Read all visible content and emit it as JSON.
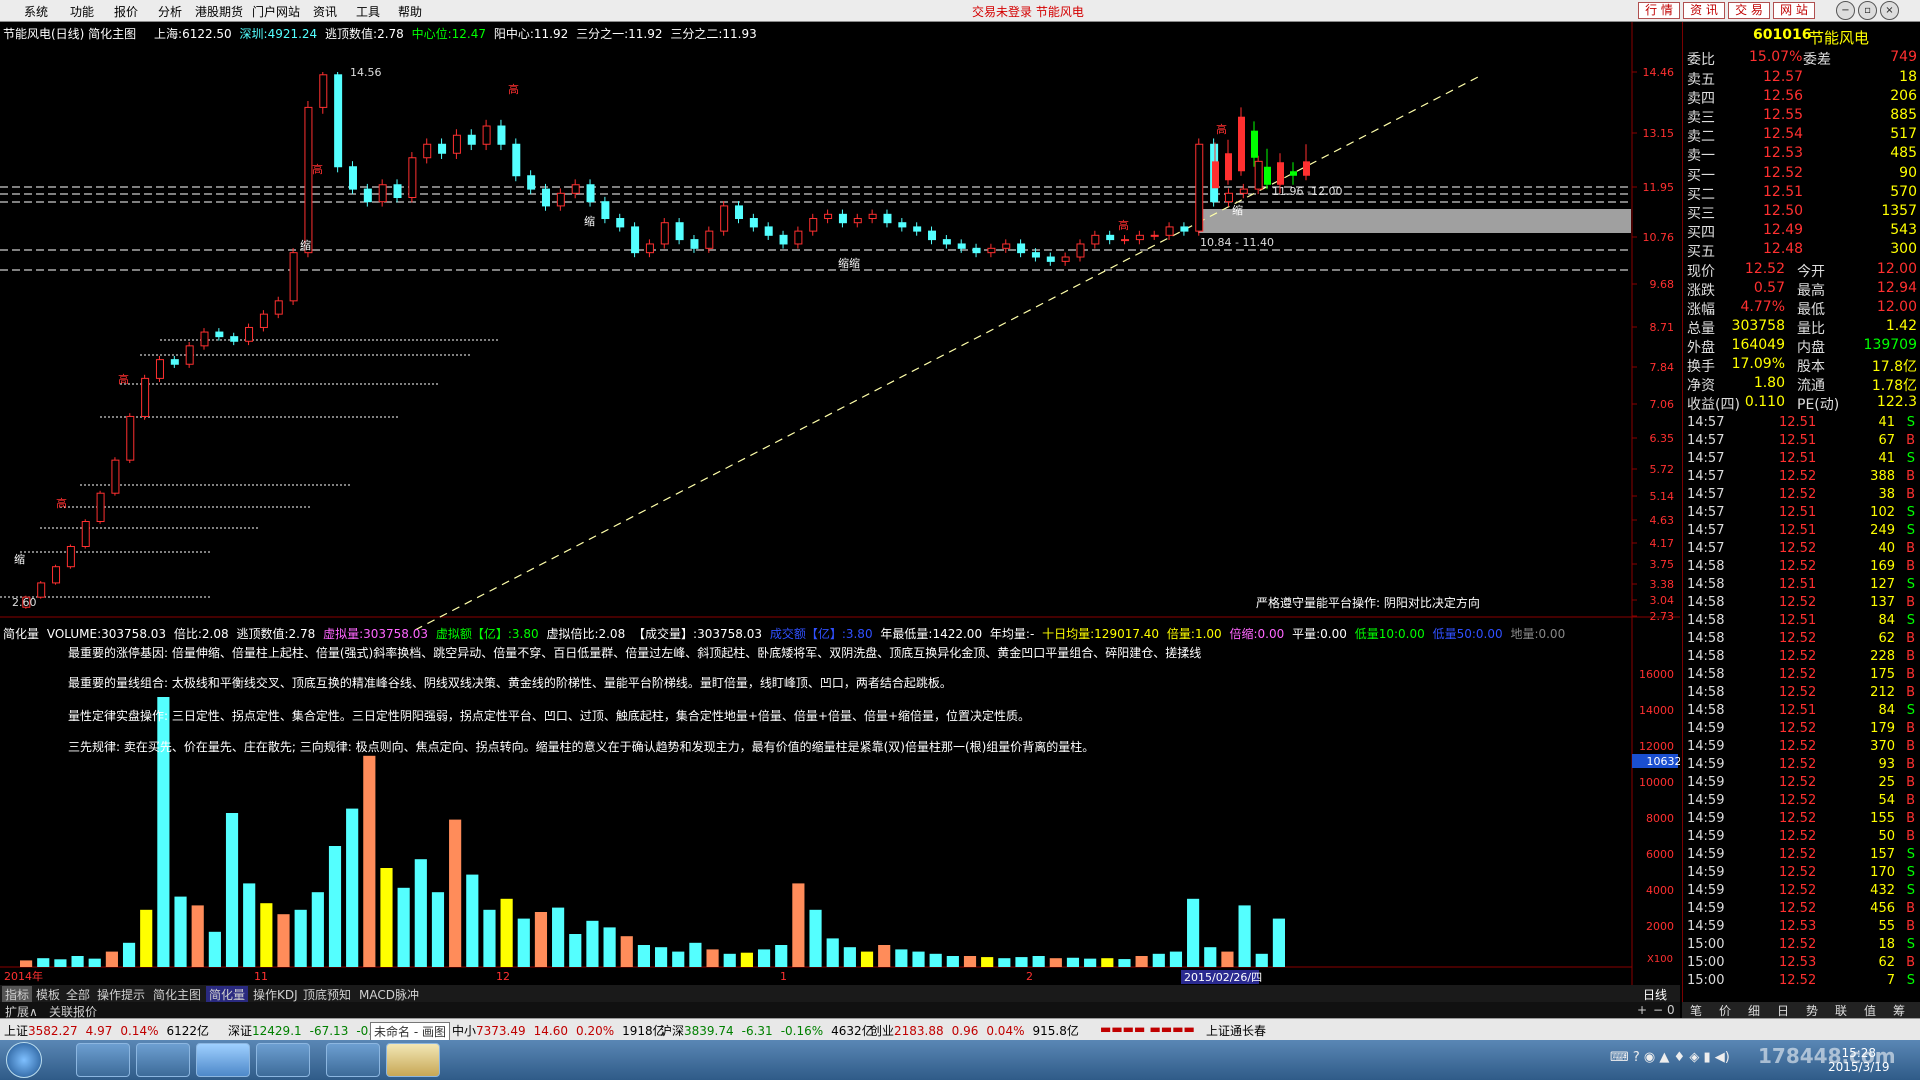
{
  "menu": [
    "系统",
    "功能",
    "报价",
    "分析",
    "港股期货",
    "门户网站",
    "资讯",
    "工具",
    "帮助"
  ],
  "trade_status": "交易未登录  节能风电",
  "top_buttons": [
    "行 情",
    "资 讯",
    "交 易",
    "网 站"
  ],
  "chart_info": {
    "title": "节能风电(日线) 简化主图",
    "sh_label": "上海:",
    "sh_val": "6122.50",
    "sz_label": "深圳:",
    "sz_val": "4921.24",
    "escape_label": "逃顶数值:",
    "escape_val": "2.78",
    "center_label": "中心位:",
    "center_val": "12.47",
    "yang_label": "阳中心:",
    "yang_val": "11.92",
    "third1_label": "三分之一:",
    "third1_val": "11.92",
    "third2_label": "三分之二:",
    "third2_val": "11.93"
  },
  "chart_data": {
    "type": "candlestick",
    "y_ticks": [
      "14.46",
      "13.15",
      "11.95",
      "10.76",
      "9.68",
      "8.71",
      "7.84",
      "7.06",
      "6.35",
      "5.72",
      "5.14",
      "4.63",
      "4.17",
      "3.75",
      "3.38",
      "3.04",
      "2.73"
    ],
    "peak_label": "14.56",
    "low_label": "2.60",
    "annotations": [
      "11.96 -12.00",
      "10.84 - 11.40",
      "严格遵守量能平台操作: 阴阳对比决定方向"
    ],
    "markers": [
      "高",
      "缩",
      "缩缩"
    ],
    "x_labels": [
      "2014年",
      "11",
      "12",
      "1",
      "2",
      "2015/02/26/四"
    ],
    "candles": [
      {
        "o": 11.92,
        "c": 12.52,
        "h": 12.94,
        "l": 12.0
      },
      {
        "o": 12.1,
        "c": 12.7,
        "h": 13.0,
        "l": 12.0
      },
      {
        "o": 12.3,
        "c": 13.5,
        "h": 13.7,
        "l": 12.2
      },
      {
        "o": 13.2,
        "c": 12.6,
        "h": 13.4,
        "l": 12.4
      },
      {
        "o": 12.4,
        "c": 12.0,
        "h": 12.8,
        "l": 11.9
      },
      {
        "o": 12.0,
        "c": 12.5,
        "h": 12.7,
        "l": 11.8
      },
      {
        "o": 12.3,
        "c": 12.2,
        "h": 12.5,
        "l": 12.0
      },
      {
        "o": 12.2,
        "c": 12.52,
        "h": 12.9,
        "l": 12.1
      }
    ],
    "volume_series": {
      "name": "VOLUME",
      "values": [
        303758.03,
        2800,
        8000,
        3400,
        2200,
        1800,
        2600,
        3300
      ]
    },
    "volume_ticks": [
      "16000",
      "14000",
      "12000",
      "10000",
      "8000",
      "6000",
      "4000",
      "2000"
    ],
    "volume_current": "10632",
    "volume_unit": "X100"
  },
  "volume_info": {
    "name": "简化量",
    "vol_label": "VOLUME:",
    "vol_val": "303758.03",
    "ratio_label": "倍比:",
    "ratio_val": "2.08",
    "escape_label": "逃顶数值:",
    "escape_val": "2.78",
    "virt_label": "虚拟量:",
    "virt_val": "303758.03",
    "virt_amt_label": "虚拟额【亿】:",
    "virt_amt_val": "3.80",
    "virt_ratio_label": "虚拟倍比:",
    "virt_ratio_val": "2.08",
    "deal_label": "【成交量】:",
    "deal_val": "303758.03",
    "deal_amt_label": "成交额【亿】:",
    "deal_amt_val": "3.80",
    "year_low_label": "年最低量:",
    "year_low_val": "1422.00",
    "year_avg_label": "年均量:",
    "year_avg_val": "-",
    "ten_avg_label": "十日均量:",
    "ten_avg_val": "129017.40",
    "bei_label": "倍量:",
    "bei_val": "1.00",
    "bs_label": "倍缩:",
    "bs_val": "0.00",
    "ping_label": "平量:",
    "ping_val": "0.00",
    "low10_label": "低量10:",
    "low10_val": "0.00",
    "low50_label": "低量50:",
    "low50_val": "0.00",
    "di_label": "地量:",
    "di_val": "0.00"
  },
  "notes": [
    "最重要的涨停基因: 倍量伸缩、倍量柱上起柱、倍量(强式)斜率换档、跳空异动、倍量不穿、百日低量群、倍量过左峰、斜顶起柱、卧底矮将军、双阴洗盘、顶底互换异化金顶、黄金凹口平量组合、碎阳建仓、搓揉线",
    "最重要的量线组合: 太极线和平衡线交叉、顶底互换的精准峰谷线、阴线双线决策、黄金线的阶梯性、量能平台阶梯线。量盯倍量，线盯峰顶、凹口，两者结合起跳板。",
    "量性定律实盘操作: 三日定性、拐点定性、集合定性。三日定性阴阳强弱，拐点定性平台、凹口、过顶、触底起柱，集合定性地量+倍量、倍量+倍量、倍量+缩倍量，位置决定性质。",
    "三先规律: 卖在买先、价在量先、庄在散先; 三向规律: 极点则向、焦点定向、拐点转向。缩量柱的意义在于确认趋势和发现主力，最有价值的缩量柱是紧靠(双)倍量柱那一(根)组量价背离的量柱。"
  ],
  "bottom_tabs": [
    "指标",
    "模板",
    "全部",
    "操作提示",
    "简化主图",
    "简化量",
    "操作KDJ",
    "顶底预知",
    "MACD脉冲"
  ],
  "ext_tabs": [
    "扩展∧",
    "关联报价"
  ],
  "right_bottom_label": "日线",
  "quote": {
    "code": "601016",
    "name": "节能风电",
    "wb_label": "委比",
    "wb_val": "15.07%",
    "wc_label": "委差",
    "wc_val": "749",
    "sells": [
      {
        "label": "卖五",
        "price": "12.57",
        "vol": "18"
      },
      {
        "label": "卖四",
        "price": "12.56",
        "vol": "206"
      },
      {
        "label": "卖三",
        "price": "12.55",
        "vol": "885"
      },
      {
        "label": "卖二",
        "price": "12.54",
        "vol": "517"
      },
      {
        "label": "卖一",
        "price": "12.53",
        "vol": "485"
      }
    ],
    "buys": [
      {
        "label": "买一",
        "price": "12.52",
        "vol": "90"
      },
      {
        "label": "买二",
        "price": "12.51",
        "vol": "570"
      },
      {
        "label": "买三",
        "price": "12.50",
        "vol": "1357"
      },
      {
        "label": "买四",
        "price": "12.49",
        "vol": "543"
      },
      {
        "label": "买五",
        "price": "12.48",
        "vol": "300"
      }
    ],
    "stats": [
      {
        "l1": "现价",
        "v1": "12.52",
        "l2": "今开",
        "v2": "12.00"
      },
      {
        "l1": "涨跌",
        "v1": "0.57",
        "l2": "最高",
        "v2": "12.94"
      },
      {
        "l1": "涨幅",
        "v1": "4.77%",
        "l2": "最低",
        "v2": "12.00"
      },
      {
        "l1": "总量",
        "v1": "303758",
        "l2": "量比",
        "v2": "1.42"
      },
      {
        "l1": "外盘",
        "v1": "164049",
        "l2": "内盘",
        "v2": "139709"
      },
      {
        "l1": "换手",
        "v1": "17.09%",
        "l2": "股本",
        "v2": "17.8亿"
      },
      {
        "l1": "净资",
        "v1": "1.80",
        "l2": "流通",
        "v2": "1.78亿"
      },
      {
        "l1": "收益(四)",
        "v1": "0.110",
        "l2": "PE(动)",
        "v2": "122.3"
      }
    ],
    "ticks": [
      {
        "t": "14:57",
        "p": "12.51",
        "v": "41",
        "d": "S"
      },
      {
        "t": "14:57",
        "p": "12.51",
        "v": "67",
        "d": "B"
      },
      {
        "t": "14:57",
        "p": "12.51",
        "v": "41",
        "d": "S"
      },
      {
        "t": "14:57",
        "p": "12.52",
        "v": "388",
        "d": "B"
      },
      {
        "t": "14:57",
        "p": "12.52",
        "v": "38",
        "d": "B"
      },
      {
        "t": "14:57",
        "p": "12.51",
        "v": "102",
        "d": "S"
      },
      {
        "t": "14:57",
        "p": "12.51",
        "v": "249",
        "d": "S"
      },
      {
        "t": "14:57",
        "p": "12.52",
        "v": "40",
        "d": "B"
      },
      {
        "t": "14:58",
        "p": "12.52",
        "v": "169",
        "d": "B"
      },
      {
        "t": "14:58",
        "p": "12.51",
        "v": "127",
        "d": "S"
      },
      {
        "t": "14:58",
        "p": "12.52",
        "v": "137",
        "d": "B"
      },
      {
        "t": "14:58",
        "p": "12.51",
        "v": "84",
        "d": "S"
      },
      {
        "t": "14:58",
        "p": "12.52",
        "v": "62",
        "d": "B"
      },
      {
        "t": "14:58",
        "p": "12.52",
        "v": "228",
        "d": "B"
      },
      {
        "t": "14:58",
        "p": "12.52",
        "v": "175",
        "d": "B"
      },
      {
        "t": "14:58",
        "p": "12.52",
        "v": "212",
        "d": "B"
      },
      {
        "t": "14:58",
        "p": "12.51",
        "v": "84",
        "d": "S"
      },
      {
        "t": "14:59",
        "p": "12.52",
        "v": "179",
        "d": "B"
      },
      {
        "t": "14:59",
        "p": "12.52",
        "v": "370",
        "d": "B"
      },
      {
        "t": "14:59",
        "p": "12.52",
        "v": "93",
        "d": "B"
      },
      {
        "t": "14:59",
        "p": "12.52",
        "v": "25",
        "d": "B"
      },
      {
        "t": "14:59",
        "p": "12.52",
        "v": "54",
        "d": "B"
      },
      {
        "t": "14:59",
        "p": "12.52",
        "v": "155",
        "d": "B"
      },
      {
        "t": "14:59",
        "p": "12.52",
        "v": "50",
        "d": "B"
      },
      {
        "t": "14:59",
        "p": "12.52",
        "v": "157",
        "d": "S"
      },
      {
        "t": "14:59",
        "p": "12.52",
        "v": "170",
        "d": "S"
      },
      {
        "t": "14:59",
        "p": "12.52",
        "v": "432",
        "d": "S"
      },
      {
        "t": "14:59",
        "p": "12.52",
        "v": "456",
        "d": "B"
      },
      {
        "t": "14:59",
        "p": "12.53",
        "v": "55",
        "d": "B"
      },
      {
        "t": "15:00",
        "p": "12.52",
        "v": "18",
        "d": "S"
      },
      {
        "t": "15:00",
        "p": "12.53",
        "v": "62",
        "d": "B"
      },
      {
        "t": "15:00",
        "p": "12.52",
        "v": "7",
        "d": "S"
      }
    ],
    "bottom_tabs": [
      "笔",
      "价",
      "细",
      "日",
      "势",
      "联",
      "值",
      "筹"
    ]
  },
  "index_bar": [
    {
      "name": "上证",
      "val": "3582.27",
      "chg": "4.97",
      "pct": "0.14%",
      "amt": "6122亿"
    },
    {
      "name": "深证",
      "val": "12429.1",
      "chg": "-67.13",
      "pct": "-0.",
      "amt": ""
    },
    {
      "name": "中小",
      "val": "7373.49",
      "chg": "14.60",
      "pct": "0.20%",
      "amt": "1918亿"
    },
    {
      "name": "沪深",
      "val": "3839.74",
      "chg": "-6.31",
      "pct": "-0.16%",
      "amt": "4632亿"
    },
    {
      "name": "创业",
      "val": "2183.88",
      "chg": "0.96",
      "pct": "0.04%",
      "amt": "915.8亿"
    }
  ],
  "popup_label": "未命名 - 画图",
  "status_right": "上证通长春",
  "clock": {
    "time": "15:28",
    "date": "2015/3/19"
  },
  "watermark": "178448.com",
  "colors": {
    "up": "#ff3030",
    "down": "#54ffff",
    "yellow": "#ffff00",
    "purple": "#ff00ff",
    "brand": "#ff6633"
  }
}
